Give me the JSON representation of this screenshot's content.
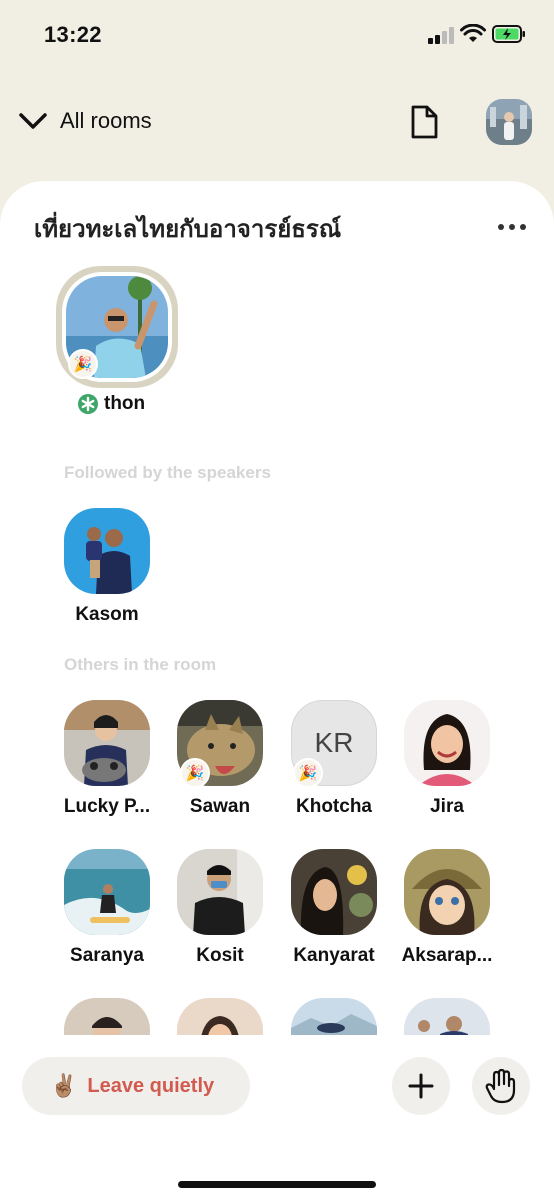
{
  "status_bar": {
    "time": "13:22"
  },
  "header": {
    "back_label": "All rooms"
  },
  "room": {
    "title": "เที่ยวทะเลไทยกับอาจารย์ธรณ์",
    "speaker": {
      "name": "thon"
    },
    "followed_section_label": "Followed by the speakers",
    "followed": [
      {
        "name": "Kasom"
      }
    ],
    "others_section_label": "Others in the room",
    "others": [
      {
        "name": "Lucky P..."
      },
      {
        "name": "Sawan"
      },
      {
        "name": "Khotcha",
        "initials": "KR"
      },
      {
        "name": "Jira"
      },
      {
        "name": "Saranya"
      },
      {
        "name": "Kosit"
      },
      {
        "name": "Kanyarat"
      },
      {
        "name": "Aksarap..."
      }
    ]
  },
  "bottom": {
    "leave_label": "Leave quietly",
    "leave_emoji": "✌🏽",
    "party_emoji": "🎉"
  },
  "colors": {
    "background": "#f1efe4",
    "leave_text": "#d25a4f",
    "moderator_green": "#3fa66a"
  }
}
